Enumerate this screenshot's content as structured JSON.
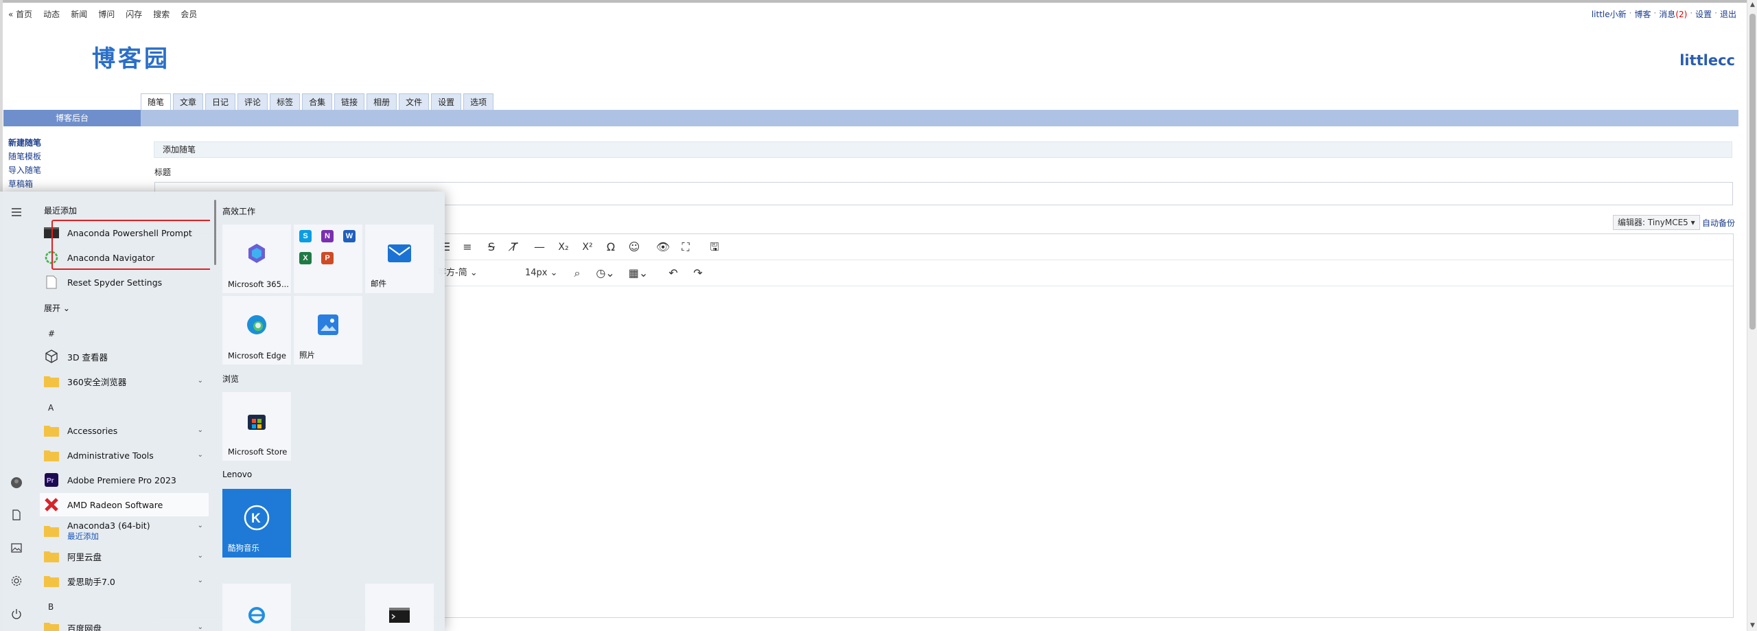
{
  "topnav": [
    "« 首页",
    "动态",
    "新闻",
    "博问",
    "闪存",
    "搜索",
    "会员"
  ],
  "userbar": {
    "user": "little小新",
    "blog": "博客",
    "msg_label": "消息",
    "msg_count": "(2)",
    "settings": "设置",
    "logout": "退出",
    "sep": "·"
  },
  "site_logo": "博客园",
  "blog_name": "littlecc",
  "admin_tabs": [
    "随笔",
    "文章",
    "日记",
    "评论",
    "标签",
    "合集",
    "链接",
    "相册",
    "文件",
    "设置",
    "选项"
  ],
  "sidebar": {
    "header": "博客后台",
    "links": [
      "新建随笔",
      "随笔模板",
      "导入随笔",
      "草稿箱"
    ]
  },
  "panel": {
    "title": "添加随笔",
    "title_label": "标题",
    "title_value": ""
  },
  "editor": {
    "editor_select": "编辑器: TinyMCE5 ▾",
    "autosave": "自动备份",
    "font_family": "苹方-简",
    "font_size": "14px"
  },
  "start_menu": {
    "recent_header": "最近添加",
    "recent": [
      {
        "label": "Anaconda Powershell Prompt",
        "icon": "terminal-icon"
      },
      {
        "label": "Anaconda Navigator",
        "icon": "anaconda-icon"
      },
      {
        "label": "Reset Spyder Settings",
        "icon": "document-icon"
      }
    ],
    "expand": "展开",
    "letters": [
      "#",
      "A",
      "B"
    ],
    "apps": [
      {
        "label": "3D 查看器",
        "icon": "cube-icon",
        "chevron": false
      },
      {
        "label": "360安全浏览器",
        "icon": "folder-icon",
        "chevron": true
      },
      {
        "label": "Accessories",
        "icon": "folder-icon",
        "chevron": true
      },
      {
        "label": "Administrative Tools",
        "icon": "folder-icon",
        "chevron": true
      },
      {
        "label": "Adobe Premiere Pro 2023",
        "icon": "premiere-icon",
        "chevron": false
      },
      {
        "label": "AMD Radeon Software",
        "icon": "amd-icon",
        "chevron": false
      },
      {
        "label": "Anaconda3 (64-bit)",
        "sub": "最近添加",
        "icon": "folder-icon",
        "chevron": true
      },
      {
        "label": "阿里云盘",
        "icon": "folder-icon",
        "chevron": true
      },
      {
        "label": "爱思助手7.0",
        "icon": "folder-icon",
        "chevron": true
      },
      {
        "label": "百度网盘",
        "icon": "folder-icon",
        "chevron": true
      }
    ],
    "tile_groups": [
      "高效工作",
      "浏览",
      "Lenovo"
    ],
    "tiles": {
      "m365": "Microsoft 365...",
      "mail": "邮件",
      "edge": "Microsoft Edge",
      "photos": "照片",
      "store": "Microsoft Store",
      "kugou": "酷狗音乐"
    },
    "office_letters": [
      "S",
      "N",
      "W",
      "X",
      "P"
    ],
    "kugou_letter": "K"
  }
}
